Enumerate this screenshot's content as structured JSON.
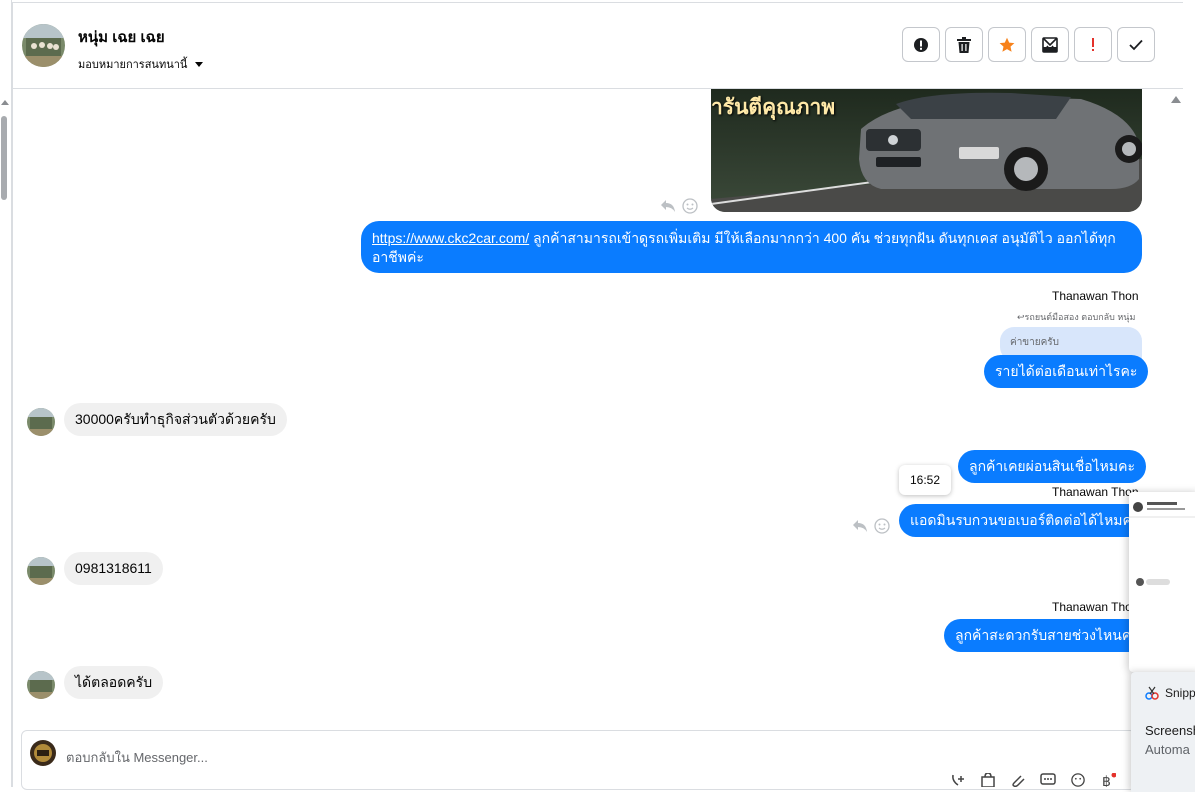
{
  "header": {
    "contact_name": "หนุ่ม เฉย เฉย",
    "assign_label": "มอบหมายการสนทนานี้"
  },
  "messages": {
    "link_message": {
      "url": "https://www.ckc2car.com/",
      "text_line1": " ลูกค้าสามารถเข้าดูรถเพิ่มเติม มีให้เลือกมากกว่า 400 คัน ช่วยทุกฝัน ดันทุกเคส อนุมัติไว ออกได้ทุก",
      "text_line2": "อาชีพค่ะ"
    },
    "car_banner_text": "ารันตีคุณภาพ",
    "sender_1": "Thanawan Thon",
    "reply_note": "รถยนต์มือสอง ตอบกลับ หนุ่ม",
    "quoted_text": "ค่าขายครับ",
    "out_1": "รายได้ต่อเดือนเท่าไรคะ",
    "in_1": "30000ครับทำธุกิจส่วนตัวด้วยครับ",
    "out_2": "ลูกค้าเคยผ่อนสินเชื่อไหมคะ",
    "tooltip_time": "16:52",
    "sender_2": "Thanawan Thon",
    "out_3": "แอดมินรบกวนขอเบอร์ติดต่อได้ไหมคะ",
    "in_2": "0981318611",
    "sender_3": "Thanawan Thon",
    "out_4": "ลูกค้าสะดวกรับสายช่วงไหนคะ",
    "in_3": "ได้ตลอดครับ"
  },
  "composer": {
    "placeholder": "ตอบกลับใน Messenger..."
  },
  "snipping": {
    "app_name": "Snipp",
    "title": "Screensh",
    "subtitle": "Automa"
  },
  "colors": {
    "accent_blue": "#0a7cff",
    "star_orange": "#f7821b",
    "alert_red": "#e4322b"
  }
}
